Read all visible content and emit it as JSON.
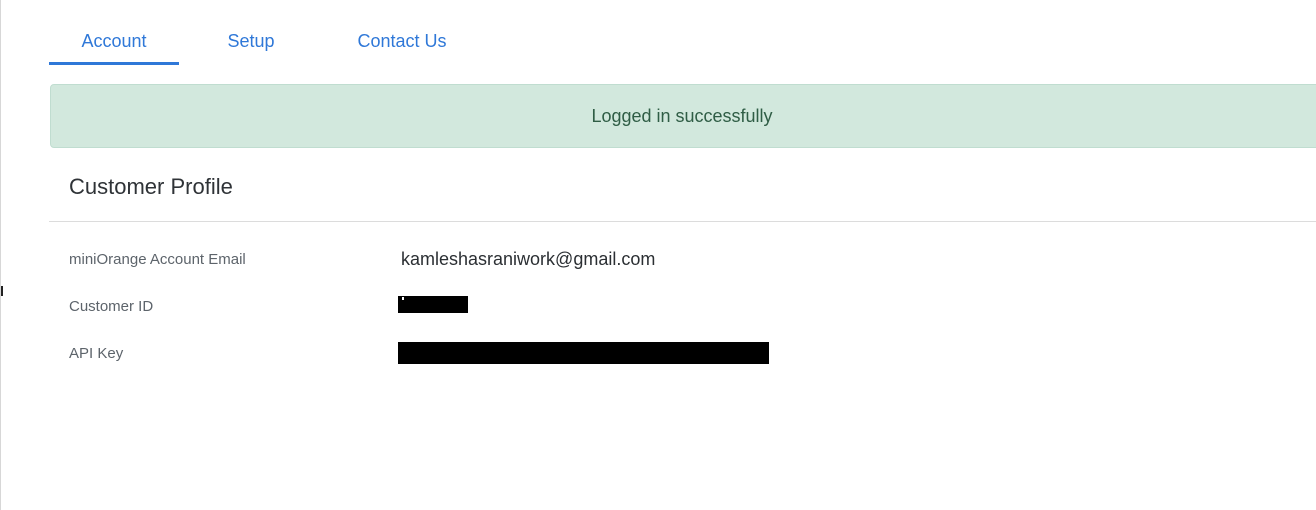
{
  "tabs": [
    {
      "label": "Account",
      "active": true
    },
    {
      "label": "Setup",
      "active": false
    },
    {
      "label": "Contact Us",
      "active": false
    }
  ],
  "alert": {
    "message": "Logged in successfully"
  },
  "profile": {
    "title": "Customer Profile",
    "rows": [
      {
        "label": "miniOrange Account Email",
        "value": "kamleshasraniwork@gmail.com",
        "redacted": false
      },
      {
        "label": "Customer ID",
        "value": "",
        "redacted": true
      },
      {
        "label": "API Key",
        "value": "",
        "redacted": true
      }
    ]
  },
  "colors": {
    "accent": "#2f78d8",
    "alert_bg": "#d2e8dd",
    "alert_text": "#2f5d45"
  }
}
